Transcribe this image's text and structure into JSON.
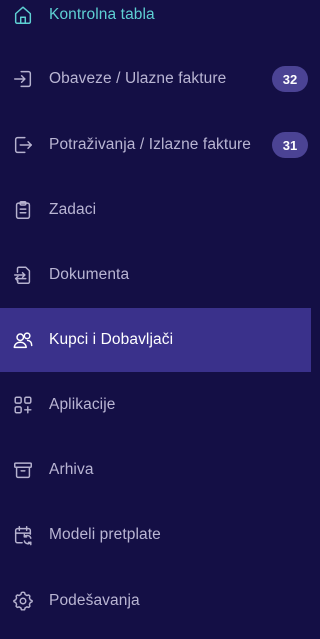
{
  "sidebar": {
    "items": [
      {
        "label": "Kontrolna tabla",
        "icon": "home-icon",
        "state": "current",
        "color": "#5ed0d3"
      },
      {
        "label": "Obaveze / Ulazne fakture",
        "icon": "sign-in-icon",
        "badge": "32"
      },
      {
        "label": "Potraživanja / Izlazne fakture",
        "icon": "sign-out-icon",
        "badge": "31"
      },
      {
        "label": "Zadaci",
        "icon": "clipboard-icon"
      },
      {
        "label": "Dokumenta",
        "icon": "document-transfer-icon"
      },
      {
        "label": "Kupci i Dobavljači",
        "icon": "users-icon",
        "state": "active",
        "color": "#3a318b"
      },
      {
        "label": "Aplikacije",
        "icon": "apps-grid-icon"
      },
      {
        "label": "Arhiva",
        "icon": "archive-icon"
      },
      {
        "label": "Modeli pretplate",
        "icon": "calendar-refresh-icon"
      },
      {
        "label": "Podešavanja",
        "icon": "gear-icon"
      }
    ]
  }
}
